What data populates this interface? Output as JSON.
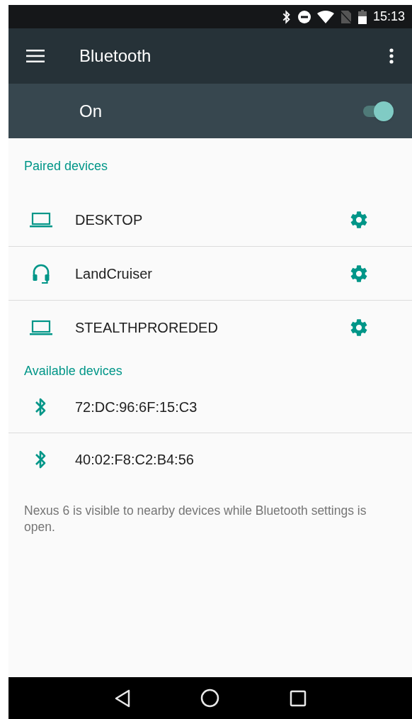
{
  "status_bar": {
    "time": "15:13"
  },
  "toolbar": {
    "title": "Bluetooth"
  },
  "master_switch": {
    "label": "On",
    "on": true
  },
  "sections": [
    {
      "title": "Paired devices",
      "devices": [
        {
          "kind": "laptop",
          "name": "DESKTOP",
          "settings": true
        },
        {
          "kind": "headset",
          "name": "LandCruiser",
          "settings": true
        },
        {
          "kind": "laptop",
          "name": "STEALTHPROREDED",
          "settings": true
        }
      ]
    },
    {
      "title": "Available devices",
      "devices": [
        {
          "kind": "bluetooth",
          "name": "72:DC:96:6F:15:C3",
          "settings": false
        },
        {
          "kind": "bluetooth",
          "name": "40:02:F8:C2:B4:56",
          "settings": false
        }
      ]
    }
  ],
  "footer": "Nexus 6 is visible to nearby devices while Bluetooth settings is open."
}
